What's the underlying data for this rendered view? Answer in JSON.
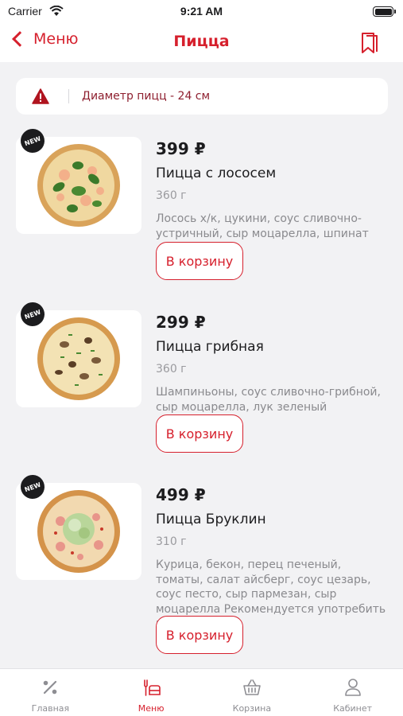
{
  "status_bar": {
    "carrier": "Carrier",
    "time": "9:21 AM"
  },
  "nav": {
    "back_label": "Меню",
    "title": "Пицца"
  },
  "banner": {
    "text": "Диаметр пицц - 24 см"
  },
  "products": [
    {
      "badge": "NEW",
      "price": "399 ₽",
      "name": "Пицца с лососем",
      "weight": "360 г",
      "description": "Лосось х/к, цукини, соус сливочно-устричный, сыр моцарелла, шпинат",
      "button": "В корзину"
    },
    {
      "badge": "NEW",
      "price": "299 ₽",
      "name": "Пицца грибная",
      "weight": "360 г",
      "description": "Шампиньоны, соус сливочно-грибной, сыр моцарелла, лук зеленый",
      "button": "В корзину"
    },
    {
      "badge": "NEW",
      "price": "499 ₽",
      "name": "Пицца Бруклин",
      "weight": "310 г",
      "description": "Курица, бекон, перец печеный, томаты, салат айсберг, соус цезарь, соус песто, сыр пармезан, сыр моцарелла Рекомендуется употребить в течение…",
      "button": "В корзину"
    }
  ],
  "tabs": [
    {
      "label": "Главная",
      "icon": "percent-icon",
      "active": false
    },
    {
      "label": "Меню",
      "icon": "menu-icon",
      "active": true
    },
    {
      "label": "Корзина",
      "icon": "basket-icon",
      "active": false
    },
    {
      "label": "Кабинет",
      "icon": "user-icon",
      "active": false
    }
  ],
  "colors": {
    "accent": "#d6202d",
    "background": "#f2f2f4",
    "banner_text": "#8e1f2f"
  }
}
